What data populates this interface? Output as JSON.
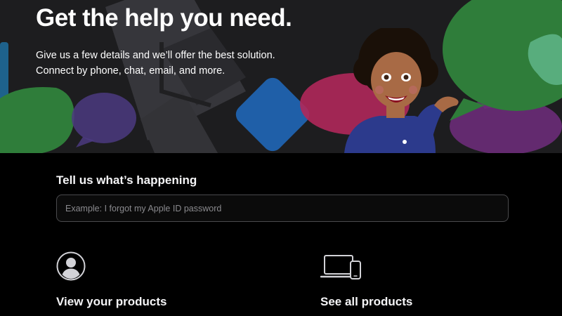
{
  "hero": {
    "title": "Get the help you need.",
    "subtitle_line_1": "Give us a few details and we’ll offer the best solution.",
    "subtitle_line_2": "Connect by phone, chat, email, and more.",
    "illustration": "memoji-waving-avatar"
  },
  "search": {
    "heading": "Tell us what’s happening",
    "placeholder": "Example: I forgot my Apple ID password",
    "value": ""
  },
  "cards": [
    {
      "label": "View your products",
      "icon": "person-circle-icon"
    },
    {
      "label": "See all products",
      "icon": "laptop-phone-icon"
    }
  ],
  "colors": {
    "hero_background": "#1d1d1f",
    "page_background": "#000000",
    "text": "#f5f5f7",
    "green": "#2f7d3a",
    "blue": "#1f5fa8",
    "magenta": "#b0285a",
    "purple": "#6b2c78"
  }
}
